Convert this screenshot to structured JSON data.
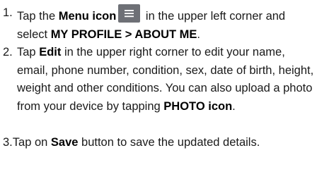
{
  "instructions": {
    "step1": {
      "number": "1.",
      "pre": "Tap the ",
      "menu_label": "Menu icon",
      "post_icon": " in the upper left corner and select ",
      "path": "MY PROFILE > ABOUT ME",
      "end": "."
    },
    "step2": {
      "number": "2.",
      "pre": "Tap ",
      "edit_label": "Edit",
      "mid": " in the upper right corner to edit your name, email, phone number, condition, sex, date of birth, height, weight and other conditions. You can also upload a photo from your device by tapping ",
      "photo_label": "PHOTO icon",
      "end": "."
    },
    "step3": {
      "number": "3.",
      "pre": "Tap on ",
      "save_label": "Save",
      "post": " button to save the updated details."
    }
  },
  "icons": {
    "menu_icon": "hamburger-menu-icon",
    "menu_icon_color": "#6e7076"
  }
}
